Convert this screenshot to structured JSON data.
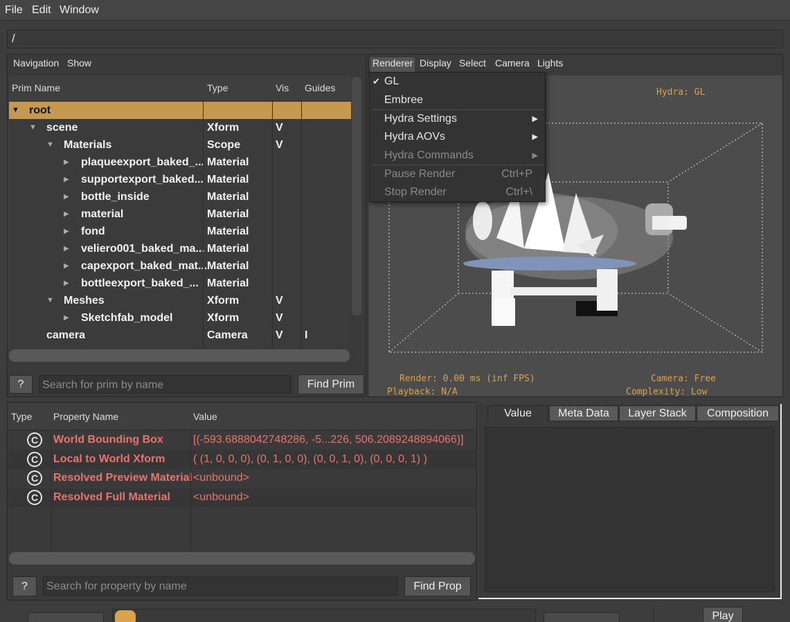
{
  "menubar": {
    "items": [
      "File",
      "Edit",
      "Window"
    ]
  },
  "path": "/",
  "nav": {
    "items": [
      "Navigation",
      "Show"
    ]
  },
  "prim_table": {
    "columns": [
      "Prim Name",
      "Type",
      "Vis",
      "Guides"
    ],
    "rows": [
      {
        "name": "root",
        "type": "",
        "vis": "",
        "guides": ""
      },
      {
        "name": "scene",
        "type": "Xform",
        "vis": "V",
        "guides": ""
      },
      {
        "name": "Materials",
        "type": "Scope",
        "vis": "V",
        "guides": ""
      },
      {
        "name": "plaqueexport_baked_...",
        "type": "Material",
        "vis": "",
        "guides": ""
      },
      {
        "name": "supportexport_baked...",
        "type": "Material",
        "vis": "",
        "guides": ""
      },
      {
        "name": "bottle_inside",
        "type": "Material",
        "vis": "",
        "guides": ""
      },
      {
        "name": "material",
        "type": "Material",
        "vis": "",
        "guides": ""
      },
      {
        "name": "fond",
        "type": "Material",
        "vis": "",
        "guides": ""
      },
      {
        "name": "veliero001_baked_ma...",
        "type": "Material",
        "vis": "",
        "guides": ""
      },
      {
        "name": "capexport_baked_mat...",
        "type": "Material",
        "vis": "",
        "guides": ""
      },
      {
        "name": "bottleexport_baked_...",
        "type": "Material",
        "vis": "",
        "guides": ""
      },
      {
        "name": "Meshes",
        "type": "Xform",
        "vis": "V",
        "guides": ""
      },
      {
        "name": "Sketchfab_model",
        "type": "Xform",
        "vis": "V",
        "guides": ""
      },
      {
        "name": "camera",
        "type": "Camera",
        "vis": "V",
        "guides": "I"
      }
    ]
  },
  "prim_search": {
    "help": "?",
    "placeholder": "Search for prim by name",
    "button": "Find Prim"
  },
  "viewport": {
    "menu": [
      "Renderer",
      "Display",
      "Select",
      "Camera",
      "Lights"
    ],
    "hud": {
      "renderer": "Hydra: GL",
      "render": "Render: 0.00 ms (inf FPS)",
      "playback": "Playback: N/A",
      "camera": "Camera: Free",
      "complexity": "Complexity: Low"
    }
  },
  "renderer_menu": {
    "items": [
      {
        "label": "GL",
        "checked": "✔",
        "shortcut": "",
        "submenu": "",
        "enabled": true
      },
      {
        "label": "Embree",
        "checked": "",
        "shortcut": "",
        "submenu": "",
        "enabled": true
      },
      {
        "label": "Hydra Settings",
        "checked": "",
        "shortcut": "",
        "submenu": "▶",
        "enabled": true
      },
      {
        "label": "Hydra AOVs",
        "checked": "",
        "shortcut": "",
        "submenu": "▶",
        "enabled": true
      },
      {
        "label": "Hydra Commands",
        "checked": "",
        "shortcut": "",
        "submenu": "▶",
        "enabled": false
      },
      {
        "label": "Pause Render",
        "checked": "",
        "shortcut": "Ctrl+P",
        "submenu": "",
        "enabled": false
      },
      {
        "label": "Stop Render",
        "checked": "",
        "shortcut": "Ctrl+\\",
        "submenu": "",
        "enabled": false
      }
    ]
  },
  "property_table": {
    "columns": [
      "Type",
      "Property Name",
      "Value"
    ],
    "rows": [
      {
        "icon": "C",
        "name": "World Bounding Box",
        "value": "[(-593.6888042748286, -5...226, 506.2089248894066)]"
      },
      {
        "icon": "C",
        "name": "Local to World Xform",
        "value": "( (1, 0, 0, 0), (0, 1, 0, 0), (0, 0, 1, 0), (0, 0, 0, 1) )"
      },
      {
        "icon": "C",
        "name": "Resolved Preview Material",
        "value": "<unbound>"
      },
      {
        "icon": "C",
        "name": "Resolved Full Material",
        "value": "<unbound>"
      }
    ]
  },
  "prop_search": {
    "help": "?",
    "placeholder": "Search for property by name",
    "button": "Find Prop"
  },
  "detail_tabs": [
    "Value",
    "Meta Data",
    "Layer Stack",
    "Composition"
  ],
  "bottom": {
    "play": "Play"
  },
  "colors": {
    "selection": "#c69a4e",
    "hud": "#d9a34a",
    "computed_property": "#e8746d"
  }
}
